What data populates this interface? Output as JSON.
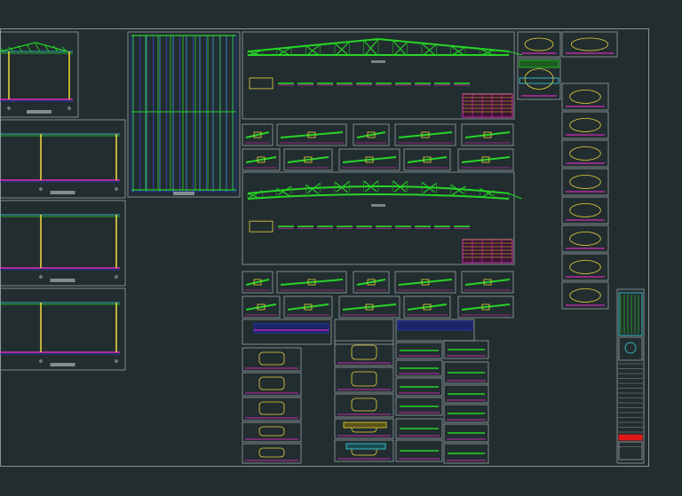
{
  "app": {
    "title": ""
  },
  "colors": {
    "background": "#222d30",
    "frame": "#9aa1a6",
    "truss": "#27d427",
    "member_magenta": "#ff2bd6",
    "member_yellow": "#e6d23a",
    "cyan": "#3fd6e6",
    "blue": "#2438c8",
    "title_block_red": "#e01818"
  },
  "sheet": {
    "panels": [
      {
        "id": "frame-elevation-1"
      },
      {
        "id": "frame-elevation-2"
      },
      {
        "id": "frame-elevation-3"
      },
      {
        "id": "frame-elevation-4"
      },
      {
        "id": "roof-plan"
      },
      {
        "id": "truss-elevation-1"
      },
      {
        "id": "truss-elevation-2"
      },
      {
        "id": "section-details"
      },
      {
        "id": "plate-details"
      },
      {
        "id": "title-block"
      }
    ]
  }
}
